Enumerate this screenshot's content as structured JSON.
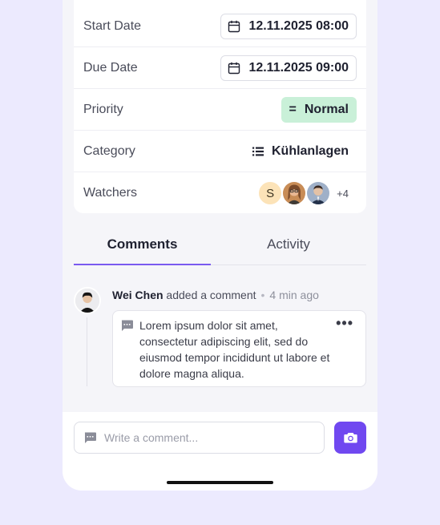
{
  "details": {
    "start_date": {
      "label": "Start Date",
      "value": "12.11.2025 08:00"
    },
    "due_date": {
      "label": "Due Date",
      "value": "12.11.2025 09:00"
    },
    "priority": {
      "label": "Priority",
      "value": "Normal",
      "color": "#C9F0D8"
    },
    "category": {
      "label": "Category",
      "value": "Kühlanlagen"
    },
    "watchers": {
      "label": "Watchers",
      "initial": "S",
      "extra": "+4"
    }
  },
  "tabs": [
    {
      "label": "Comments",
      "active": true
    },
    {
      "label": "Activity",
      "active": false
    }
  ],
  "comment": {
    "author": "Wei Chen",
    "action": "added a comment",
    "time": "4 min ago",
    "text": "Lorem ipsum dolor sit amet, consectetur adipiscing elit, sed do eiusmod tempor incididunt ut labore et dolore magna aliqua."
  },
  "composer": {
    "placeholder": "Write a comment..."
  },
  "colors": {
    "background": "#ECEAFE",
    "accent": "#7048F0",
    "priority_normal": "#C9F0D8"
  },
  "icons": [
    "calendar-icon",
    "equals-icon",
    "list-icon",
    "message-icon",
    "more-icon",
    "camera-icon"
  ]
}
